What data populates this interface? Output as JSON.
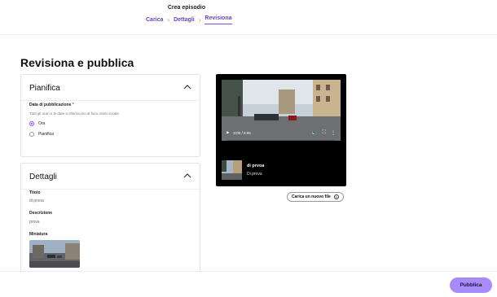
{
  "header": {
    "title": "Crea episodio",
    "breadcrumbs": [
      {
        "label": "Carica"
      },
      {
        "label": "Dettagli"
      },
      {
        "label": "Revisiona"
      }
    ],
    "active_step": "Revisiona"
  },
  "page_title": "Revisiona e pubblica",
  "schedule": {
    "title": "Pianifica",
    "date_label": "Data di pubblicazione",
    "required_mark": "*",
    "hint": "Tutti gli orari e le date si riferiscono al fuso orario locale",
    "options": [
      {
        "label": "Ora",
        "selected": true
      },
      {
        "label": "Pianifica",
        "selected": false
      }
    ]
  },
  "details": {
    "title": "Dettagli",
    "title_label": "Titolo",
    "title_value": "di prvoa",
    "description_label": "Descrizione",
    "description_value": "prova",
    "thumbnail_label": "Miniatura"
  },
  "player": {
    "time": "0:00 / 0:05",
    "progress": 0.0,
    "episode_title": "di prvoa",
    "episode_subtitle": "Di prova"
  },
  "upload_button": "Carica un nuovo file",
  "publish_button": "Pubblica",
  "colors": {
    "accent": "#7c4dff",
    "publish": "#a78bfa"
  }
}
